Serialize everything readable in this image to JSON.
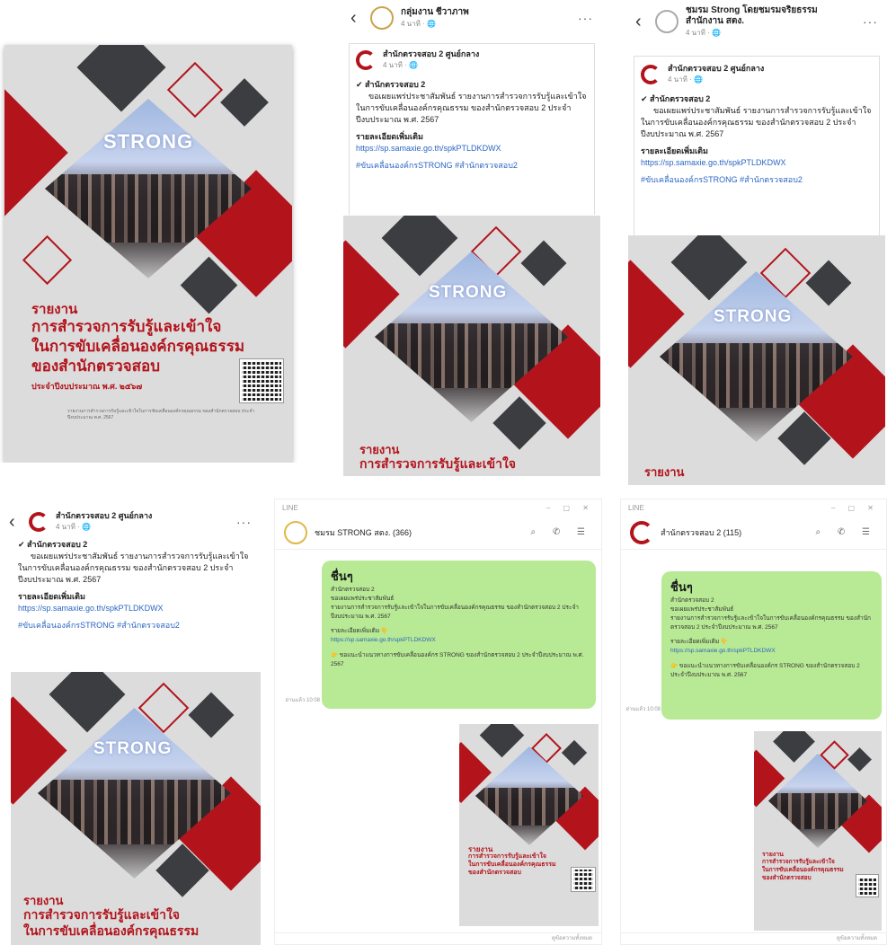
{
  "poster": {
    "brand": "STRONG",
    "report": "รายงาน",
    "line1": "การสำรวจการรับรู้และเข้าใจ",
    "line2": "ในการขับเคลื่อนองค์กรคุณธรรม",
    "line3": "ของสำนักตรวจสอบ",
    "line4": "ประจำปีงบประมาณ พ.ศ. ๒๕๖๗",
    "fine": "รายงานการสำรวจการรับรู้และเข้าใจในการขับเคลื่อนองค์กรคุณธรรม ของสำนักตรวจสอบ ประจำปีงบประมาณ พ.ศ. 2567"
  },
  "fb_post_1": {
    "page_name": "กลุ่มงาน ชีวาภาพ",
    "page_sub": "4 นาที · 🌐",
    "shared_name": "สำนักตรวจสอบ 2 ศูนย์กลาง",
    "shared_sub": "4 นาที · 🌐",
    "body": "✔ สำนักตรวจสอบ 2",
    "body2": "ขอเผยแพร่ประชาสัมพันธ์ รายงานการสำรวจการรับรู้และเข้าใจในการขับเคลื่อนองค์กรคุณธรรม ของสำนักตรวจสอบ 2 ประจำปีงบประมาณ พ.ศ. 2567",
    "link_label": "รายละเอียดเพิ่มเติม",
    "link": "https://sp.samaxie.go.th/spkPTLDKDWX",
    "tags": "#ขับเคลื่อนองค์กรSTRONG #สำนักตรวจสอบ2"
  },
  "fb_post_2": {
    "page_name": "ชมรม Strong โดยชมรมจริยธรรม",
    "page_name2": "สำนักงาน สตง.",
    "page_sub": "4 นาที · 🌐",
    "shared_name": "สำนักตรวจสอบ 2 ศูนย์กลาง",
    "shared_sub": "4 นาที · 🌐",
    "body": "✔ สำนักตรวจสอบ 2",
    "body2": "ขอเผยแพร่ประชาสัมพันธ์ รายงานการสำรวจการรับรู้และเข้าใจในการขับเคลื่อนองค์กรคุณธรรม ของสำนักตรวจสอบ 2 ประจำปีงบประมาณ พ.ศ. 2567",
    "link_label": "รายละเอียดเพิ่มเติม",
    "link": "https://sp.samaxie.go.th/spkPTLDKDWX",
    "tags": "#ขับเคลื่อนองค์กรSTRONG #สำนักตรวจสอบ2"
  },
  "fb_post_3": {
    "page_name": "สำนักตรวจสอบ 2 ศูนย์กลาง",
    "page_sub": "4 นาที · 🌐",
    "body": "✔ สำนักตรวจสอบ 2",
    "body2": "ขอเผยแพร่ประชาสัมพันธ์ รายงานการสำรวจการรับรู้และเข้าใจในการขับเคลื่อนองค์กรคุณธรรม ของสำนักตรวจสอบ 2 ประจำปีงบประมาณ พ.ศ. 2567",
    "link_label": "รายละเอียดเพิ่มเติม",
    "link": "https://sp.samaxie.go.th/spkPTLDKDWX",
    "tags": "#ขับเคลื่อนองค์กรSTRONG #สำนักตรวจสอบ2"
  },
  "line_chat_1": {
    "window_label": "LINE",
    "title": "ชมรม STRONG สตง. (366)",
    "greet": "ชื่นๆ",
    "msg1": "สำนักตรวจสอบ 2",
    "msg2": "ขอเผยแพร่ประชาสัมพันธ์",
    "msg3": "รายงานการสำรวจการรับรู้และเข้าใจในการขับเคลื่อนองค์กรคุณธรรม ของสำนักตรวจสอบ 2 ประจำปีงบประมาณ พ.ศ. 2567",
    "msg4": "รายละเอียดเพิ่มเติม 👇",
    "link": "https://sp.samaxie.go.th/spkPTLDKDWX",
    "msg5": "👉 ขอแนะนำแนวทางการขับเคลื่อนองค์กร STRONG ของสำนักตรวจสอบ 2 ประจำปีงบประมาณ พ.ศ. 2567",
    "time": "อ่านแล้ว 10:08",
    "footer": "ดูข้อความทั้งหมด"
  },
  "line_chat_2": {
    "window_label": "LINE",
    "title": "สำนักตรวจสอบ 2 (115)",
    "greet": "ชื่นๆ",
    "msg1": "สำนักตรวจสอบ 2",
    "msg2": "ขอเผยแพร่ประชาสัมพันธ์",
    "msg3": "รายงานการสำรวจการรับรู้และเข้าใจในการขับเคลื่อนองค์กรคุณธรรม ของสำนักตรวจสอบ 2 ประจำปีงบประมาณ พ.ศ. 2567",
    "msg4": "รายละเอียดเพิ่มเติม 👇",
    "link": "https://sp.samaxie.go.th/spkPTLDKDWX",
    "msg5": "👉 ขอแนะนำแนวทางการขับเคลื่อนองค์กร STRONG ของสำนักตรวจสอบ 2 ประจำปีงบประมาณ พ.ศ. 2567",
    "time": "อ่านแล้ว 10:08",
    "footer": "ดูข้อความทั้งหมด"
  }
}
